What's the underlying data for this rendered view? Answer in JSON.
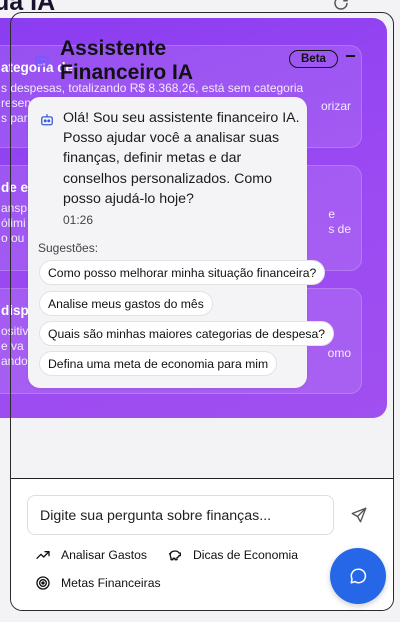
{
  "background": {
    "title": "ua IA",
    "cards": [
      {
        "heading": "ategoria de ",
        "lines": [
          "s despesas, totalizando R$ 8.368,26, está sem categoria",
          "resen",
          "s para"
        ],
        "right_text": "orizar"
      },
      {
        "heading": "de e",
        "lines": [
          "ansp",
          "ólimi",
          "o ou c"
        ],
        "right_text": "e\ns de"
      },
      {
        "heading": "disp",
        "lines": [
          "ositiv",
          "e va",
          "ando s"
        ],
        "right_text": "omo"
      }
    ]
  },
  "chat": {
    "title_line1": "Assistente",
    "title_line2": "Financeiro IA",
    "badge": "Beta",
    "message": "Olá! Sou seu assistente financeiro IA. Posso ajudar você a analisar suas finanças, definir metas e dar conselhos personalizados. Como posso ajudá-lo hoje?",
    "time": "01:26",
    "suggestions_label": "Sugestões:",
    "suggestions": [
      "Como posso melhorar minha situação financeira?",
      "Analise meus gastos do mês",
      "Quais são minhas maiores categorias de despesa?",
      "Defina uma meta de economia para mim"
    ],
    "input_placeholder": "Digite sua pergunta sobre finanças...",
    "quick_actions": [
      {
        "label": "Analisar Gastos",
        "icon": "trending-up-icon"
      },
      {
        "label": "Dicas de Economia",
        "icon": "piggy-bank-icon"
      },
      {
        "label": "Metas Financeiras",
        "icon": "target-icon"
      }
    ]
  },
  "colors": {
    "panel_purple": "#9b4af2",
    "fab_blue": "#2667e8"
  }
}
